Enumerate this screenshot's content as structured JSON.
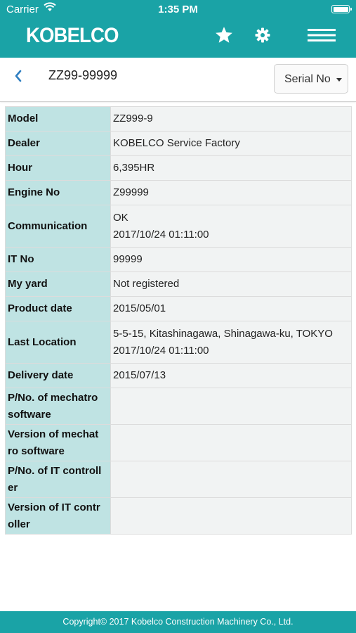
{
  "status_bar": {
    "carrier": "Carrier",
    "time": "1:35 PM"
  },
  "header": {
    "logo": "KOBELCO",
    "accent_color": "#1aa3a6"
  },
  "subheader": {
    "title": "ZZ99-99999",
    "dropdown_label": "Serial No"
  },
  "rows": [
    {
      "key": "Model",
      "value": "ZZ999-9"
    },
    {
      "key": "Dealer",
      "value": "KOBELCO Service Factory"
    },
    {
      "key": "Hour",
      "value": "6,395HR"
    },
    {
      "key": "Engine No",
      "value": "Z99999"
    },
    {
      "key": "Communication",
      "value_line1": "OK",
      "value_line2": "2017/10/24 01:11:00"
    },
    {
      "key": "IT No",
      "value": "99999"
    },
    {
      "key": "My yard",
      "value": "Not registered"
    },
    {
      "key": "Product date",
      "value": "2015/05/01"
    },
    {
      "key": "Last Location",
      "value_line1": "5-5-15, Kitashinagawa, Shinagawa-ku, TOKYO",
      "value_line2": "2017/10/24 01:11:00"
    },
    {
      "key": "Delivery date",
      "value": "2015/07/13"
    },
    {
      "key_line1": "P/No. of mechatro",
      "key_line2": "software",
      "value": ""
    },
    {
      "key_line1": "Version of mechat",
      "key_line2": "ro software",
      "value": ""
    },
    {
      "key_line1": "P/No. of IT controll",
      "key_line2": "er",
      "value": ""
    },
    {
      "key_line1": "Version of IT contr",
      "key_line2": "oller",
      "value": ""
    }
  ],
  "footer": {
    "copyright": "Copyright© 2017 Kobelco Construction Machinery Co., Ltd."
  }
}
